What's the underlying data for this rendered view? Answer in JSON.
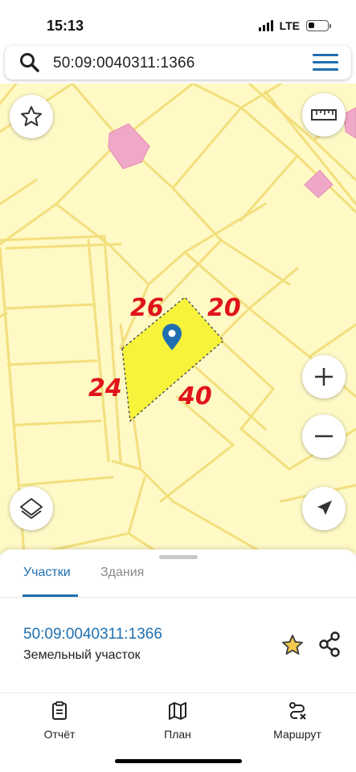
{
  "status": {
    "time": "15:13",
    "network": "LTE"
  },
  "search": {
    "query": "50:09:0040311:1366"
  },
  "map": {
    "annotations": [
      "26",
      "20",
      "24",
      "40"
    ],
    "buttons": [
      "star-icon",
      "ruler-icon",
      "zoom-in-icon",
      "zoom-out-icon",
      "layers-icon",
      "location-arrow-icon"
    ],
    "colors": {
      "background": "#fef9c5",
      "lines": "#f2df7d",
      "parcel": "#f7f33a",
      "buildings": "#f0a8c8",
      "annotation": "#e0141b"
    }
  },
  "sheet": {
    "tabs": [
      {
        "label": "Участки"
      },
      {
        "label": "Здания"
      }
    ],
    "parcel": {
      "number": "50:09:0040311:1366",
      "type": "Земельный участок"
    }
  },
  "nav": {
    "items": [
      {
        "label": "Отчёт"
      },
      {
        "label": "План"
      },
      {
        "label": "Маршрут"
      }
    ]
  },
  "accent_color": "#1f6fb0"
}
